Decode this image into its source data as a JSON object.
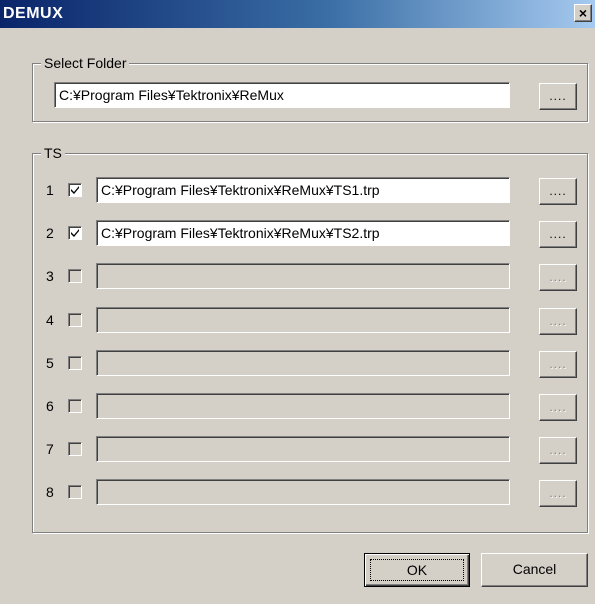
{
  "window": {
    "title": "DEMUX",
    "close_glyph": "×"
  },
  "select_folder": {
    "legend": "Select Folder",
    "path": "C:¥Program Files¥Tektronix¥ReMux",
    "browse_label": "...."
  },
  "ts": {
    "legend": "TS",
    "rows": [
      {
        "num": "1",
        "checked": true,
        "path": "C:¥Program Files¥Tektronix¥ReMux¥TS1.trp",
        "enabled": true,
        "browse_label": "...."
      },
      {
        "num": "2",
        "checked": true,
        "path": "C:¥Program Files¥Tektronix¥ReMux¥TS2.trp",
        "enabled": true,
        "browse_label": "...."
      },
      {
        "num": "3",
        "checked": false,
        "path": "",
        "enabled": false,
        "browse_label": "...."
      },
      {
        "num": "4",
        "checked": false,
        "path": "",
        "enabled": false,
        "browse_label": "...."
      },
      {
        "num": "5",
        "checked": false,
        "path": "",
        "enabled": false,
        "browse_label": "...."
      },
      {
        "num": "6",
        "checked": false,
        "path": "",
        "enabled": false,
        "browse_label": "...."
      },
      {
        "num": "7",
        "checked": false,
        "path": "",
        "enabled": false,
        "browse_label": "...."
      },
      {
        "num": "8",
        "checked": false,
        "path": "",
        "enabled": false,
        "browse_label": "...."
      }
    ]
  },
  "buttons": {
    "ok": "OK",
    "cancel": "Cancel"
  }
}
